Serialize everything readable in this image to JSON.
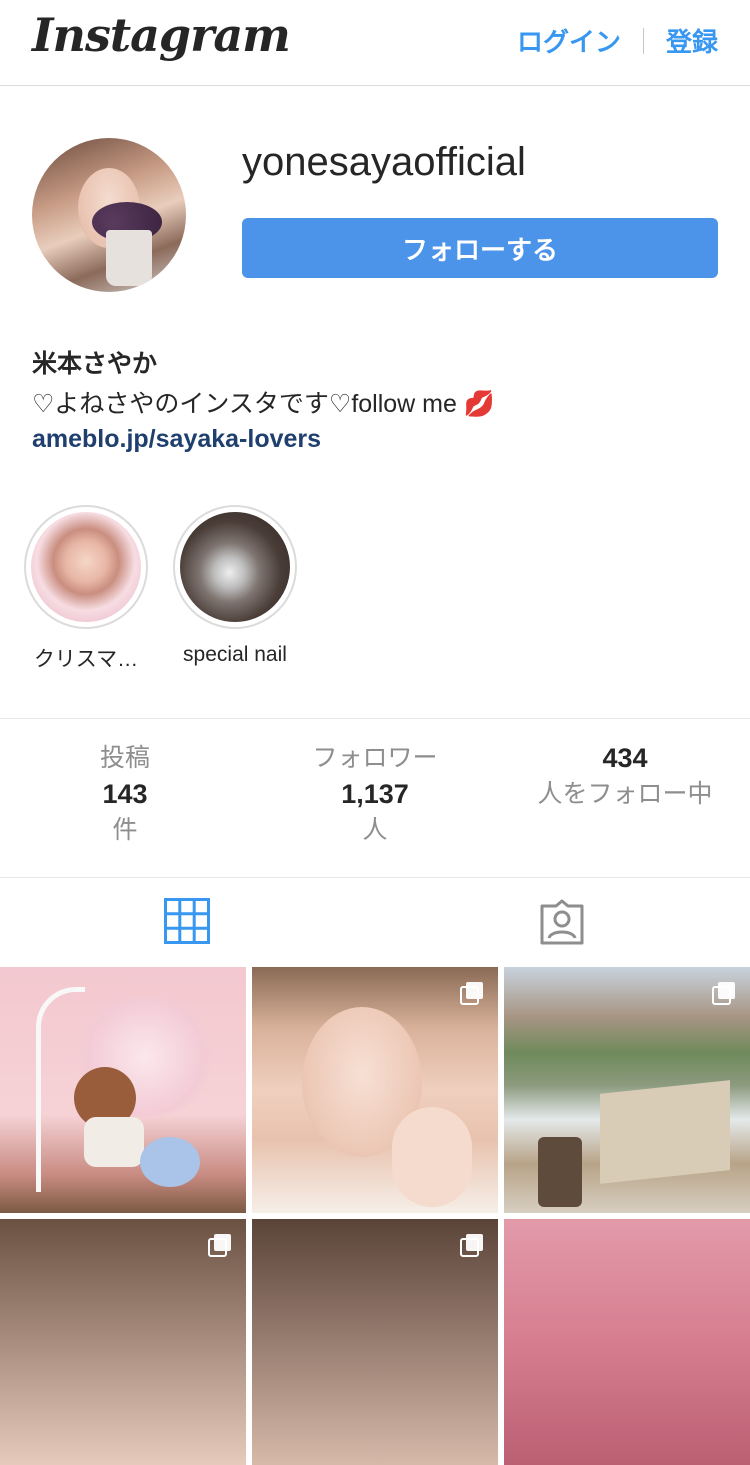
{
  "header": {
    "logo_text": "Instagram",
    "login_label": "ログイン",
    "register_label": "登録",
    "accent_color": "#3897f0"
  },
  "profile": {
    "username": "yonesayaofficial",
    "follow_label": "フォローする",
    "name": "米本さやか",
    "bio": "♡よねさやのインスタです♡follow me 💋",
    "link": "ameblo.jp/sayaka-lovers"
  },
  "highlights": [
    {
      "label": "クリスマ…"
    },
    {
      "label": "special nail"
    }
  ],
  "stats": {
    "posts": {
      "label": "投稿",
      "value": "143",
      "unit": "件"
    },
    "followers": {
      "label": "フォロワー",
      "value": "1,137",
      "unit": "人"
    },
    "following": {
      "value": "434",
      "label": "人をフォロー中"
    }
  },
  "tabs": [
    {
      "icon": "grid-icon",
      "active": true
    },
    {
      "icon": "tagged-icon",
      "active": false
    }
  ],
  "posts": [
    {
      "icon": "image"
    },
    {
      "icon": "multiple-photos-icon"
    },
    {
      "icon": "multiple-photos-icon"
    },
    {
      "icon": "multiple-photos-icon"
    },
    {
      "icon": "multiple-photos-icon"
    },
    {
      "icon": "image"
    }
  ]
}
